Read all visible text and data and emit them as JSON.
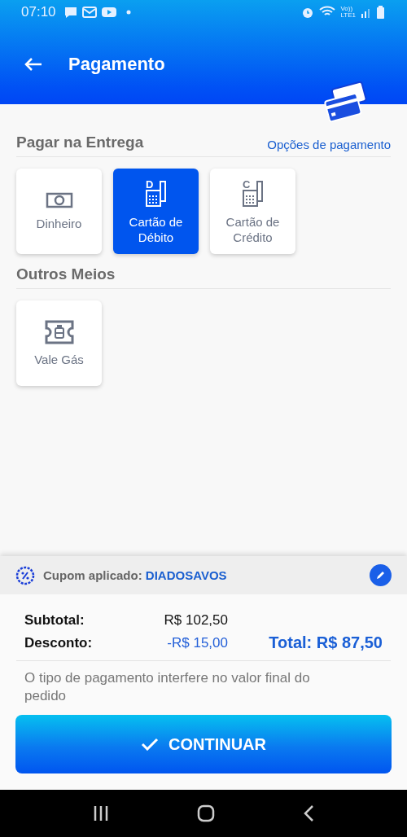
{
  "status_bar": {
    "time": "07:10",
    "network_top": "Vo))",
    "network_bottom": "LTE1"
  },
  "header": {
    "title": "Pagamento"
  },
  "sections": [
    {
      "title": "Pagar na Entrega",
      "link": "Opções de pagamento",
      "options": [
        {
          "kind": "cash",
          "label": "Dinheiro",
          "selected": false
        },
        {
          "kind": "terminal",
          "badge": "D",
          "label": "Cartão de Débito",
          "selected": true
        },
        {
          "kind": "terminal",
          "badge": "C",
          "label": "Cartão de Crédito",
          "selected": false
        }
      ]
    },
    {
      "title": "Outros Meios",
      "options": [
        {
          "kind": "voucher",
          "label": "Vale Gás",
          "selected": false
        }
      ]
    }
  ],
  "coupon": {
    "label": "Cupom aplicado:",
    "code": "DIADOSAVOS"
  },
  "summary": {
    "subtotal_label": "Subtotal:",
    "subtotal": "R$ 102,50",
    "discount_label": "Desconto:",
    "discount": "-R$ 15,00",
    "total": "Total: R$ 87,50"
  },
  "note": "O tipo de pagamento interfere no valor final do pedido",
  "continue_button": "CONTINUAR"
}
